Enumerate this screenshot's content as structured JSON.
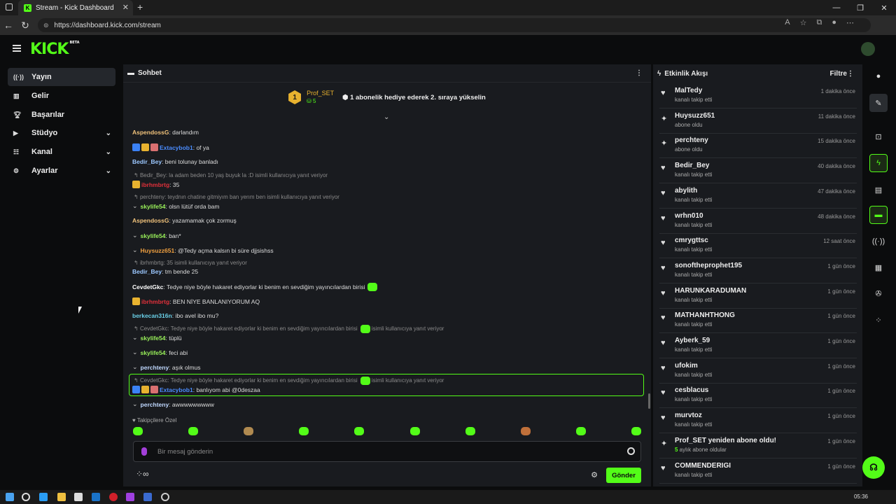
{
  "browser": {
    "tab_title": "Stream - Kick Dashboard",
    "url": "https://dashboard.kick.com/stream"
  },
  "header": {
    "logo": "KICK",
    "logo_badge": "BETA"
  },
  "sidebar": {
    "items": [
      {
        "label": "Yayın",
        "icon": "broadcast-icon"
      },
      {
        "label": "Gelir",
        "icon": "chart-icon"
      },
      {
        "label": "Başarılar",
        "icon": "trophy-icon"
      },
      {
        "label": "Stüdyo",
        "icon": "video-icon"
      },
      {
        "label": "Kanal",
        "icon": "users-icon"
      },
      {
        "label": "Ayarlar",
        "icon": "gear-icon"
      }
    ]
  },
  "chat": {
    "title": "Sohbet",
    "pinned": {
      "rank": "1",
      "user": "Prof_SET",
      "count": "5",
      "message": "1 abonelik hediye ederek 2. sıraya yükselin"
    },
    "messages": [
      {
        "user": "AspendossG",
        "text": ": darlandım"
      },
      {
        "user": "Extacybob1",
        "text": ": of ya"
      },
      {
        "user": "Bedir_Bey",
        "text": ": beni tolunay banladı"
      },
      {
        "reply": "Bedir_Bey: la adam beden 10 yaş buyuk la :D isimli kullanıcıya yanıt veriyor"
      },
      {
        "user": "ibrhmbrtg",
        "text": ": 35"
      },
      {
        "reply": "perchteny: teydnın chatine gitmiyım ban yerım ben isimli kullanıcıya yanıt veriyor"
      },
      {
        "user": "skylife54",
        "text": ": olsn lütüf orda bam"
      },
      {
        "user": "AspendossG",
        "text": ": yazamamak çok zormuş"
      },
      {
        "user": "skylife54",
        "text": ": ban*"
      },
      {
        "user": "Huysuzz651",
        "text": ": @Tedy açma kalsın bi süre djjsishss"
      },
      {
        "reply": "ibrhmbrtg: 35 isimli kullanıcıya yanıt veriyor"
      },
      {
        "user": "Bedir_Bey",
        "text": ": tm bende 25"
      },
      {
        "user": "CevdetGkc",
        "text": ": Tedye niye böyle hakaret ediyorlar ki benim en sevdiğim yayıncılardan birisi"
      },
      {
        "user": "ibrhmbrtg",
        "text": ": BEN NİYE BANLANIYORUM AQ"
      },
      {
        "user": "berkecan316n",
        "text": ": ibo avel ibo mu?"
      },
      {
        "reply": "CevdetGkc: Tedye niye böyle hakaret ediyorlar ki benim en sevdiğim yayıncılardan birisi",
        "reply_suffix": "isimli kullanıcıya yanıt veriyor"
      },
      {
        "user": "skylife54",
        "text": ": tüplü"
      },
      {
        "user": "skylife54",
        "text": ": feci abi"
      },
      {
        "user": "perchteny",
        "text": ": aşık olmus"
      },
      {
        "reply": "CevdetGkc: Tedye niye böyle hakaret ediyorlar ki benim en sevdiğim yayıncılardan birisi",
        "reply_suffix": "isimli kullanıcıya yanıt veriyor"
      },
      {
        "user": "Extacybob1",
        "text": ": banlıyom abi @0deszaa"
      },
      {
        "user": "perchteny",
        "text": ": awwwwwwwww"
      }
    ],
    "followers_only": "Takipçilere Özel",
    "input_placeholder": "Bir mesaj gönderin",
    "send_label": "Gönder"
  },
  "activity": {
    "title": "Etkinlik Akışı",
    "filter_label": "Filtre",
    "items": [
      {
        "name": "MalTedy",
        "sub": "kanalı takip etti",
        "time": "1 dakika önce",
        "icon": "heart-icon"
      },
      {
        "name": "Huysuzz651",
        "sub": "abone oldu",
        "time": "11 dakika önce",
        "icon": "star-icon"
      },
      {
        "name": "perchteny",
        "sub": "abone oldu",
        "time": "15 dakika önce",
        "icon": "star-icon"
      },
      {
        "name": "Bedir_Bey",
        "sub": "kanalı takip etti",
        "time": "40 dakika önce",
        "icon": "heart-icon"
      },
      {
        "name": "abylith",
        "sub": "kanalı takip etti",
        "time": "47 dakika önce",
        "icon": "heart-icon"
      },
      {
        "name": "wrhn010",
        "sub": "kanalı takip etti",
        "time": "48 dakika önce",
        "icon": "heart-icon"
      },
      {
        "name": "cmrygttsc",
        "sub": "kanalı takip etti",
        "time": "12 saat önce",
        "icon": "heart-icon"
      },
      {
        "name": "sonoftheprophet195",
        "sub": "kanalı takip etti",
        "time": "1 gün önce",
        "icon": "heart-icon"
      },
      {
        "name": "HARUNKARADUMAN",
        "sub": "kanalı takip etti",
        "time": "1 gün önce",
        "icon": "heart-icon"
      },
      {
        "name": "MATHANHTHONG",
        "sub": "kanalı takip etti",
        "time": "1 gün önce",
        "icon": "heart-icon"
      },
      {
        "name": "Ayberk_59",
        "sub": "kanalı takip etti",
        "time": "1 gün önce",
        "icon": "heart-icon"
      },
      {
        "name": "ufokim",
        "sub": "kanalı takip etti",
        "time": "1 gün önce",
        "icon": "heart-icon"
      },
      {
        "name": "cesblacus",
        "sub": "kanalı takip etti",
        "time": "1 gün önce",
        "icon": "heart-icon"
      },
      {
        "name": "murvtoz",
        "sub": "kanalı takip etti",
        "time": "1 gün önce",
        "icon": "heart-icon"
      },
      {
        "name": "Prof_SET yeniden abone oldu!",
        "sub_highlight": "5",
        "sub": " aylık abone oldular",
        "time": "1 gün önce",
        "icon": "star-icon"
      },
      {
        "name": "COMMENDERIGI",
        "sub": "kanalı takip etti",
        "time": "1 gün önce",
        "icon": "heart-icon"
      }
    ]
  },
  "taskbar": {
    "time": "05:36"
  },
  "colors": {
    "accent": "#53fc18",
    "gold": "#e8b22f",
    "panel": "#191b1f"
  }
}
